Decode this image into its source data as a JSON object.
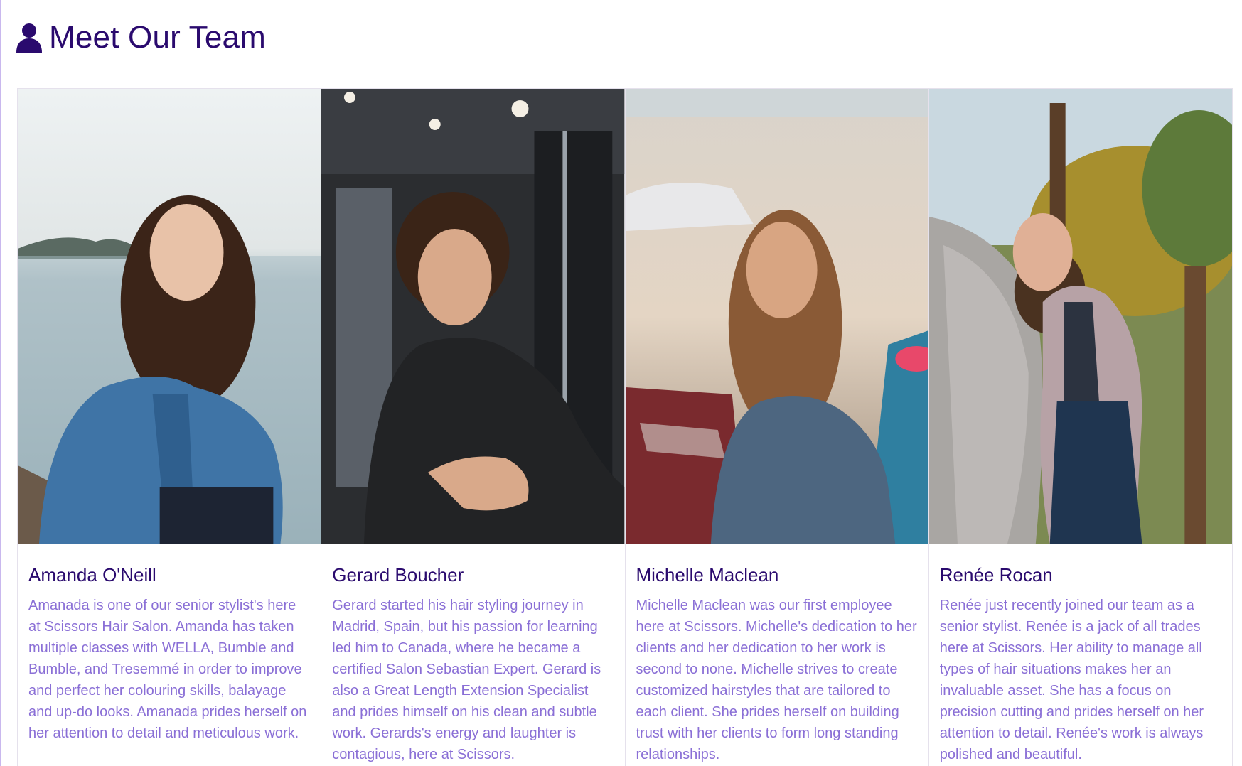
{
  "header": {
    "icon": "user-icon",
    "title": "Meet Our Team"
  },
  "team": [
    {
      "name": "Amanda O'Neill",
      "bio": "Amanada is one of our senior stylist's here at Scissors Hair Salon. Amanda has taken multiple classes with WELLA, Bumble and Bumble, and Tresemmé in order to improve and perfect her colouring skills, balayage and up-do looks. Amanada prides herself on her attention to detail and meticulous work.",
      "photo": "woman-lakeside-denim-jacket-photo"
    },
    {
      "name": "Gerard Boucher",
      "bio": "Gerard started his hair styling journey in Madrid, Spain, but his passion for learning led him to Canada, where he became a certified Salon Sebastian Expert. Gerard is also a Great Length Extension Specialist and prides himself on his clean and subtle work. Gerards's energy and laughter is contagious, here at Scissors.",
      "photo": "man-curly-hair-black-scrubs-photo"
    },
    {
      "name": "Michelle Maclean",
      "bio": "Michelle Maclean was our first employee here at Scissors. Michelle's dedication to her clients and her dedication to her work is second to none. Michelle strives to create customized hairstyles that are tailored to each client. She prides herself on building trust with her clients to form long standing relationships.",
      "photo": "woman-beach-denim-jacket-photo"
    },
    {
      "name": "Renée Rocan",
      "bio": "Renée just recently joined our team as a senior stylist. Renée is a jack of all trades here at Scissors. Her ability to manage all types of hair situations makes her an invaluable asset. She has a focus on precision cutting and prides herself on her attention to detail. Renée's work is always polished and beautiful.",
      "photo": "woman-forest-pink-cardigan-photo"
    }
  ],
  "colors": {
    "heading": "#2a0a6e",
    "bio_text": "#8a6fd6",
    "border": "#e5e1ec"
  }
}
